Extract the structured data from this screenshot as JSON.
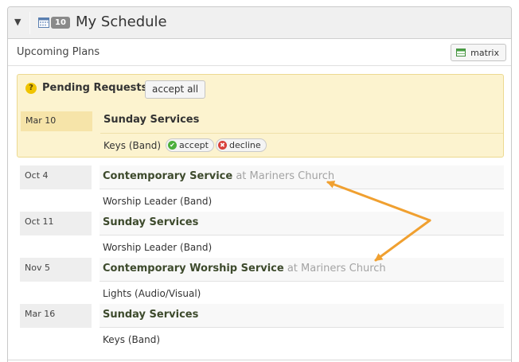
{
  "header": {
    "toggle_glyph": "▼",
    "count": "10",
    "title": "My Schedule"
  },
  "subbar": {
    "title": "Upcoming Plans",
    "matrix_label": "matrix"
  },
  "pending": {
    "title": "Pending Requests",
    "accept_all": "accept all",
    "date": "Mar 10",
    "plan": "Sunday Services",
    "position": "Keys (Band)",
    "accept_label": "accept",
    "decline_label": "decline"
  },
  "plans": [
    {
      "date": "Oct 4",
      "name": "Contemporary Service",
      "location": "at Mariners Church",
      "position": "Worship Leader (Band)"
    },
    {
      "date": "Oct 11",
      "name": "Sunday Services",
      "location": "",
      "position": "Worship Leader (Band)"
    },
    {
      "date": "Nov 5",
      "name": "Contemporary Worship Service",
      "location": "at Mariners Church",
      "position": "Lights (Audio/Visual)"
    },
    {
      "date": "Mar 16",
      "name": "Sunday Services",
      "location": "",
      "position": "Keys (Band)"
    }
  ],
  "colors": {
    "annotation_arrow": "#f0a030",
    "pending_bg": "#fcf3cf",
    "plan_name": "#3d4a2c"
  }
}
